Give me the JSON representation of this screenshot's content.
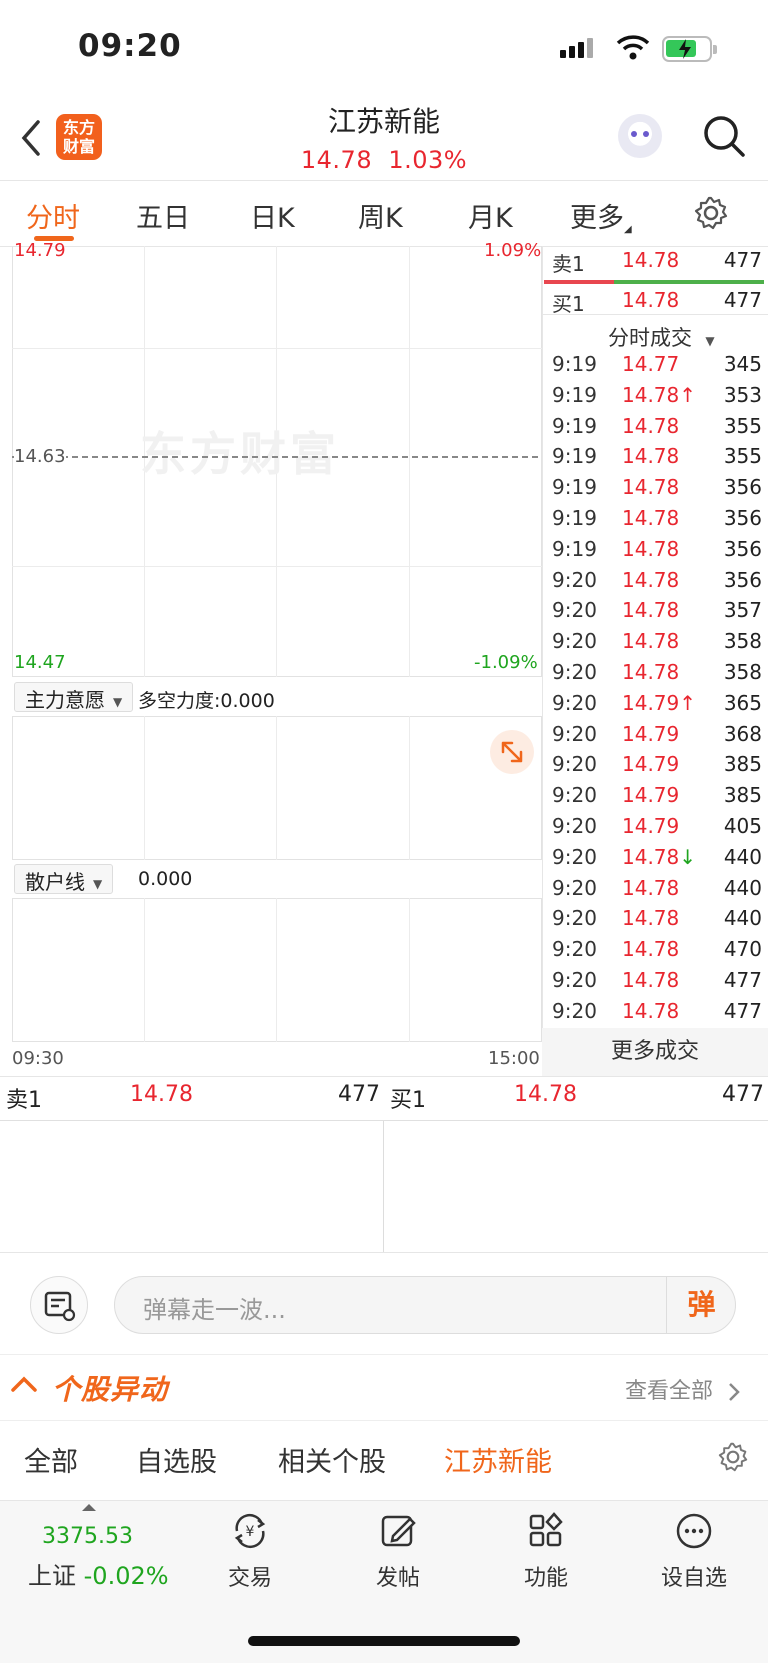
{
  "status_bar": {
    "time": "09:20"
  },
  "header": {
    "logo_text": "东方财富",
    "stock_name": "江苏新能",
    "price": "14.78",
    "change_pct": "1.03%"
  },
  "tabs": [
    {
      "label": "分时"
    },
    {
      "label": "五日"
    },
    {
      "label": "日K"
    },
    {
      "label": "周K"
    },
    {
      "label": "月K"
    },
    {
      "label": "更多"
    }
  ],
  "chart": {
    "watermark": "东方财富",
    "y_top_left": "14.79",
    "y_top_right": "1.09%",
    "y_mid": "14.63",
    "y_bottom_left": "14.47",
    "y_bottom_right": "-1.09%",
    "x_start": "09:30",
    "x_end": "15:00"
  },
  "indicator1": {
    "name": "主力意愿",
    "label": "多空力度:0.000"
  },
  "indicator2": {
    "name": "散户线",
    "value": "0.000"
  },
  "order_panel": {
    "sell1_label": "卖1",
    "sell1_price": "14.78",
    "sell1_vol": "477",
    "buy1_label": "买1",
    "buy1_price": "14.78",
    "buy1_vol": "477"
  },
  "trades_title": "分时成交",
  "trades": [
    {
      "time": "9:19",
      "price": "14.77",
      "vol": "345"
    },
    {
      "time": "9:19",
      "price": "14.78↑",
      "vol": "353"
    },
    {
      "time": "9:19",
      "price": "14.78",
      "vol": "355"
    },
    {
      "time": "9:19",
      "price": "14.78",
      "vol": "355"
    },
    {
      "time": "9:19",
      "price": "14.78",
      "vol": "356"
    },
    {
      "time": "9:19",
      "price": "14.78",
      "vol": "356"
    },
    {
      "time": "9:19",
      "price": "14.78",
      "vol": "356"
    },
    {
      "time": "9:20",
      "price": "14.78",
      "vol": "356"
    },
    {
      "time": "9:20",
      "price": "14.78",
      "vol": "357"
    },
    {
      "time": "9:20",
      "price": "14.78",
      "vol": "358"
    },
    {
      "time": "9:20",
      "price": "14.78",
      "vol": "358"
    },
    {
      "time": "9:20",
      "price": "14.79↑",
      "vol": "365"
    },
    {
      "time": "9:20",
      "price": "14.79",
      "vol": "368"
    },
    {
      "time": "9:20",
      "price": "14.79",
      "vol": "385"
    },
    {
      "time": "9:20",
      "price": "14.79",
      "vol": "385"
    },
    {
      "time": "9:20",
      "price": "14.79",
      "vol": "405"
    },
    {
      "time": "9:20",
      "price": "14.78↓",
      "vol": "440"
    },
    {
      "time": "9:20",
      "price": "14.78",
      "vol": "440"
    },
    {
      "time": "9:20",
      "price": "14.78",
      "vol": "440"
    },
    {
      "time": "9:20",
      "price": "14.78",
      "vol": "470"
    },
    {
      "time": "9:20",
      "price": "14.78",
      "vol": "477"
    },
    {
      "time": "9:20",
      "price": "14.78",
      "vol": "477"
    }
  ],
  "more_trades": "更多成交",
  "bottom_order": {
    "sell1_label": "卖1",
    "sell1_price": "14.78",
    "sell1_vol": "477",
    "buy1_label": "买1",
    "buy1_price": "14.78",
    "buy1_vol": "477"
  },
  "danmu": {
    "placeholder": "弹幕走一波...",
    "button": "弹"
  },
  "movement": {
    "title": "个股异动",
    "view_all": "查看全部"
  },
  "filter_tabs": [
    {
      "label": "全部"
    },
    {
      "label": "自选股"
    },
    {
      "label": "相关个股"
    },
    {
      "label": "江苏新能"
    }
  ],
  "nav": {
    "index_value": "3375.53",
    "index_name": "上证",
    "index_change": "-0.02%",
    "items": [
      {
        "label": "交易"
      },
      {
        "label": "发帖"
      },
      {
        "label": "功能"
      },
      {
        "label": "设自选"
      }
    ]
  }
}
